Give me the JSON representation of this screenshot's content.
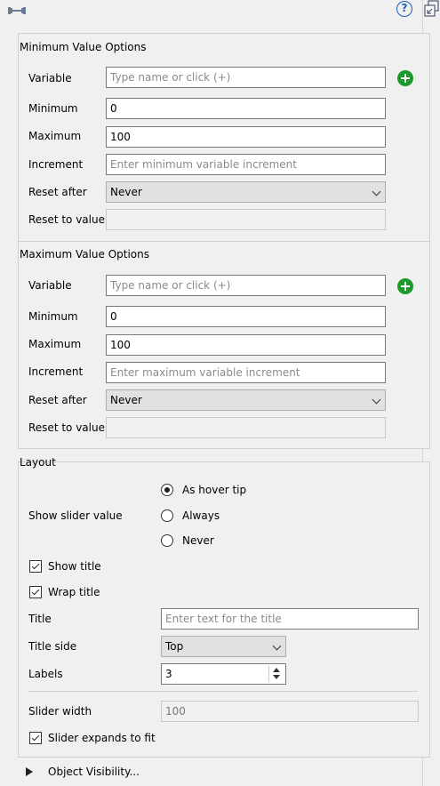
{
  "toolbar": {
    "help_symbol": "?"
  },
  "min_options": {
    "title": "Minimum Value Options",
    "variable_label": "Variable",
    "variable_placeholder": "Type name or click (+)",
    "minimum_label": "Minimum",
    "minimum_value": "0",
    "maximum_label": "Maximum",
    "maximum_value": "100",
    "increment_label": "Increment",
    "increment_placeholder": "Enter minimum variable increment",
    "reset_after_label": "Reset after",
    "reset_after_value": "Never",
    "reset_to_label": "Reset to value"
  },
  "max_options": {
    "title": "Maximum Value Options",
    "variable_label": "Variable",
    "variable_placeholder": "Type name or click (+)",
    "minimum_label": "Minimum",
    "minimum_value": "0",
    "maximum_label": "Maximum",
    "maximum_value": "100",
    "increment_label": "Increment",
    "increment_placeholder": "Enter maximum variable increment",
    "reset_after_label": "Reset after",
    "reset_after_value": "Never",
    "reset_to_label": "Reset to value"
  },
  "layout": {
    "title": "Layout",
    "show_slider_value_label": "Show slider value",
    "radio_options": [
      "As hover tip",
      "Always",
      "Never"
    ],
    "selected_radio": "As hover tip",
    "show_title_label": "Show title",
    "show_title_checked": true,
    "wrap_title_label": "Wrap title",
    "wrap_title_checked": true,
    "title_label": "Title",
    "title_placeholder": "Enter text for the title",
    "title_side_label": "Title side",
    "title_side_value": "Top",
    "labels_label": "Labels",
    "labels_value": "3",
    "slider_width_label": "Slider width",
    "slider_width_value": "100",
    "slider_expands_label": "Slider expands to fit",
    "slider_expands_checked": true
  },
  "object_visibility": {
    "label": "Object Visibility..."
  }
}
